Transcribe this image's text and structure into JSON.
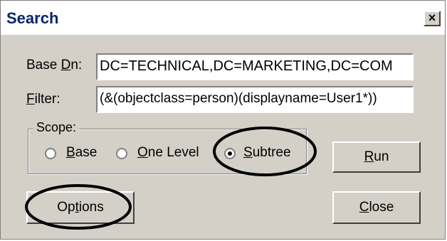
{
  "window": {
    "title": "Search",
    "close_glyph": "×"
  },
  "base_dn": {
    "label_pre": "Base ",
    "label_mn": "D",
    "label_post": "n:",
    "value": "DC=TECHNICAL,DC=MARKETING,DC=COM"
  },
  "filter": {
    "label_mn": "F",
    "label_post": "ilter:",
    "value": "(&(objectclass=person)(displayname=User1*))"
  },
  "scope": {
    "legend": "Scope:",
    "options": [
      {
        "mn": "B",
        "rest": "ase",
        "selected": false
      },
      {
        "mn": "O",
        "rest": "ne Level",
        "selected": false
      },
      {
        "mn": "S",
        "rest": "ubtree",
        "selected": true
      }
    ]
  },
  "buttons": {
    "run": {
      "mn": "R",
      "rest": "un"
    },
    "options": {
      "pre": "Op",
      "mn": "t",
      "post": "ions"
    },
    "close": {
      "mn": "C",
      "rest": "lose"
    }
  },
  "annotations": {
    "color": "#000000"
  }
}
